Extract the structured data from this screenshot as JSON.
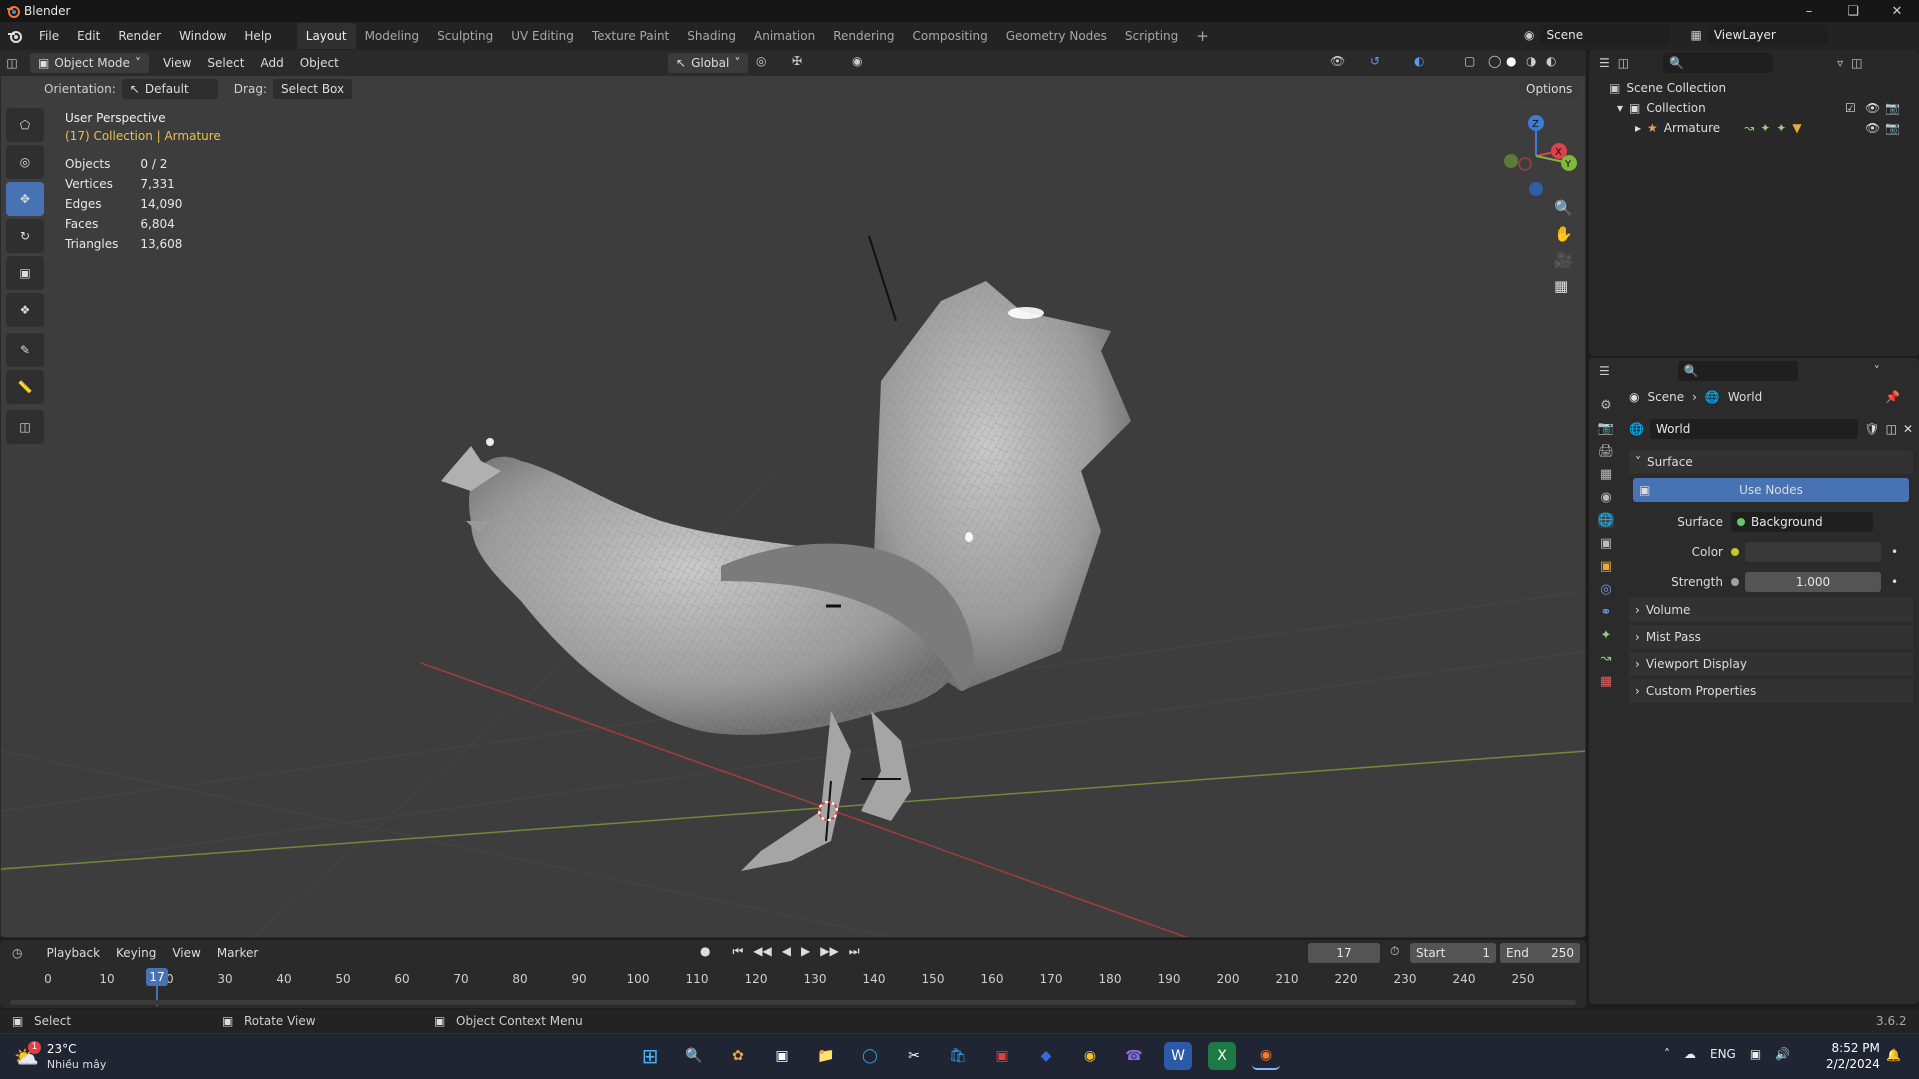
{
  "window": {
    "title": "Blender"
  },
  "menubar": {
    "menus": [
      "File",
      "Edit",
      "Render",
      "Window",
      "Help"
    ],
    "workspaces": [
      "Layout",
      "Modeling",
      "Sculpting",
      "UV Editing",
      "Texture Paint",
      "Shading",
      "Animation",
      "Rendering",
      "Compositing",
      "Geometry Nodes",
      "Scripting"
    ],
    "active_workspace": "Layout",
    "scene": "Scene",
    "view_layer": "ViewLayer"
  },
  "viewport_header": {
    "mode": "Object Mode",
    "menus": [
      "View",
      "Select",
      "Add",
      "Object"
    ],
    "transform_orientation": "Global",
    "options_label": "Options"
  },
  "tool_settings": {
    "orientation_label": "Orientation:",
    "orientation_value": "Default",
    "drag_label": "Drag:",
    "drag_value": "Select Box"
  },
  "viewport_overlay": {
    "perspective": "User Perspective",
    "collection_info": "(17) Collection | Armature",
    "stats": [
      {
        "label": "Objects",
        "value": "0 / 2"
      },
      {
        "label": "Vertices",
        "value": "7,331"
      },
      {
        "label": "Edges",
        "value": "14,090"
      },
      {
        "label": "Faces",
        "value": "6,804"
      },
      {
        "label": "Triangles",
        "value": "13,608"
      }
    ],
    "gizmo_axes": [
      "Z",
      "X",
      "Y"
    ]
  },
  "outliner": {
    "root": "Scene Collection",
    "collection": "Collection",
    "object": "Armature"
  },
  "properties": {
    "breadcrumb_scene": "Scene",
    "breadcrumb_world": "World",
    "world_name": "World",
    "panel_surface": "Surface",
    "use_nodes_label": "Use Nodes",
    "surface_label": "Surface",
    "surface_value": "Background",
    "color_label": "Color",
    "strength_label": "Strength",
    "strength_value": "1.000",
    "collapsed_panels": [
      "Volume",
      "Mist Pass",
      "Viewport Display",
      "Custom Properties"
    ]
  },
  "timeline": {
    "menus": [
      "Playback",
      "Keying",
      "View",
      "Marker"
    ],
    "current_frame": "17",
    "start_label": "Start",
    "start_value": "1",
    "end_label": "End",
    "end_value": "250",
    "ruler": [
      "0",
      "10",
      "20",
      "30",
      "40",
      "50",
      "60",
      "70",
      "80",
      "90",
      "100",
      "110",
      "120",
      "130",
      "140",
      "150",
      "160",
      "170",
      "180",
      "190",
      "200",
      "210",
      "220",
      "230",
      "240",
      "250"
    ],
    "playhead_label": "17"
  },
  "statusbar": {
    "hints": [
      "Select",
      "Rotate View",
      "Object Context Menu"
    ],
    "version": "3.6.2"
  },
  "taskbar": {
    "weather_temp": "23°C",
    "weather_text": "Nhiều mây",
    "notification_badge": "1",
    "language": "ENG",
    "time": "8:52 PM",
    "date": "2/2/2024"
  },
  "colors": {
    "accent": "#4772b3",
    "axis_x": "#e0404a",
    "axis_y": "#7fb83a",
    "axis_z": "#3d7bd8",
    "highlight_text": "#e8c14d"
  }
}
